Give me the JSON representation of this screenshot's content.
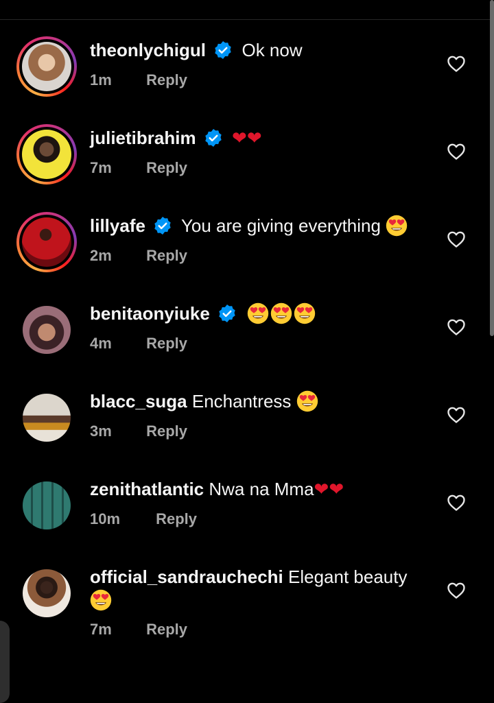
{
  "comments": [
    {
      "username": "theonlychigul",
      "verified": true,
      "text": "Ok now",
      "time": "1m",
      "reply": "Reply",
      "story_ring": true,
      "avatar_color": "#b07a5a"
    },
    {
      "username": "julietibrahim",
      "verified": true,
      "text": "❤❤",
      "time": "7m",
      "reply": "Reply",
      "story_ring": true,
      "avatar_color": "#e8d31a"
    },
    {
      "username": "lillyafe",
      "verified": true,
      "text": "You are giving everything",
      "emoji": "heart-eyes",
      "time": "2m",
      "reply": "Reply",
      "story_ring": true,
      "avatar_color": "#a51119"
    },
    {
      "username": "benitaonyiuke",
      "verified": true,
      "text": "",
      "emoji_count": 3,
      "time": "4m",
      "reply": "Reply",
      "story_ring": false,
      "avatar_color": "#8a5a60"
    },
    {
      "username": "blacc_suga",
      "verified": false,
      "text": "Enchantress",
      "emoji": "heart-eyes",
      "time": "3m",
      "reply": "Reply",
      "story_ring": false,
      "avatar_color": "#c9c2b4"
    },
    {
      "username": "zenithatlantic",
      "verified": false,
      "text": "Nwa na Mma",
      "hearts": "❤❤",
      "time": "10m",
      "reply": "Reply",
      "story_ring": false,
      "avatar_color": "#2d6b63"
    },
    {
      "username": "official_sandrauchechi",
      "verified": false,
      "text": "Elegant beauty",
      "emoji": "heart-eyes",
      "time": "7m",
      "reply": "Reply",
      "story_ring": false,
      "avatar_color": "#e4ddd6"
    }
  ],
  "icons": {
    "verified": "verified-badge-icon",
    "like": "heart-outline-icon",
    "emoji": "heart-eyes-emoji"
  },
  "colors": {
    "background": "#000000",
    "verified": "#0095f6",
    "heart": "#e0162b",
    "muted": "#a8a8a8"
  }
}
